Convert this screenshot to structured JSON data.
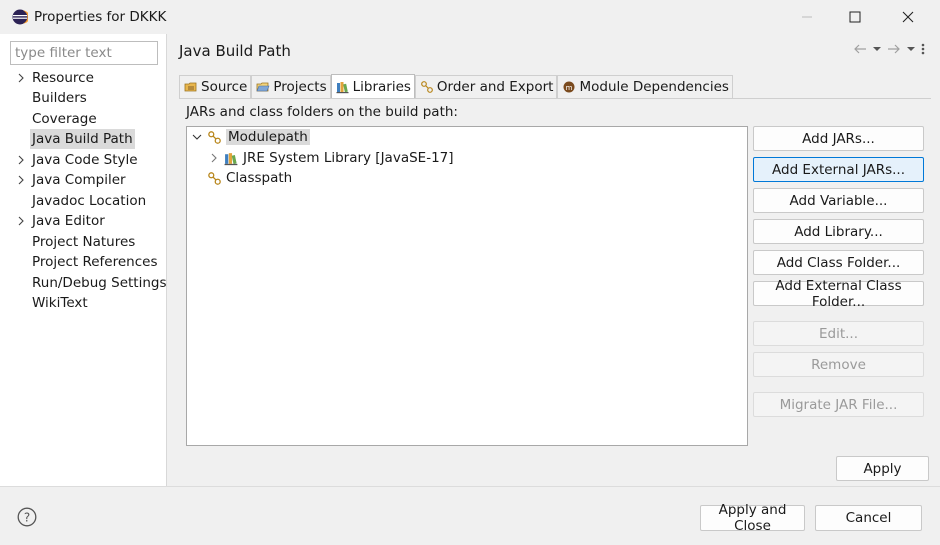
{
  "window": {
    "title": "Properties for DKKK"
  },
  "sidebar": {
    "filter_placeholder": "type filter text",
    "items": [
      {
        "label": "Resource",
        "expandable": true
      },
      {
        "label": "Builders",
        "expandable": false
      },
      {
        "label": "Coverage",
        "expandable": false
      },
      {
        "label": "Java Build Path",
        "expandable": false,
        "selected": true
      },
      {
        "label": "Java Code Style",
        "expandable": true
      },
      {
        "label": "Java Compiler",
        "expandable": true
      },
      {
        "label": "Javadoc Location",
        "expandable": false
      },
      {
        "label": "Java Editor",
        "expandable": true
      },
      {
        "label": "Project Natures",
        "expandable": false
      },
      {
        "label": "Project References",
        "expandable": false
      },
      {
        "label": "Run/Debug Settings",
        "expandable": false
      },
      {
        "label": "WikiText",
        "expandable": false
      }
    ]
  },
  "page": {
    "title": "Java Build Path",
    "tabs": [
      {
        "label": "Source",
        "icon": "source-folder-icon"
      },
      {
        "label": "Projects",
        "icon": "projects-folder-icon"
      },
      {
        "label": "Libraries",
        "icon": "libraries-icon",
        "active": true
      },
      {
        "label": "Order and Export",
        "icon": "order-export-icon"
      },
      {
        "label": "Module Dependencies",
        "icon": "module-icon"
      }
    ],
    "section_label": "JARs and class folders on the build path:",
    "tree": [
      {
        "label": "Modulepath",
        "icon": "classpath-container-icon",
        "expanded": true,
        "selected": true
      },
      {
        "label": "JRE System Library [JavaSE-17]",
        "icon": "library-icon",
        "expanded": false
      },
      {
        "label": "Classpath",
        "icon": "classpath-container-icon"
      }
    ],
    "buttons": {
      "add_jars": "Add JARs...",
      "add_external_jars": "Add External JARs...",
      "add_variable": "Add Variable...",
      "add_library": "Add Library...",
      "add_class_folder": "Add Class Folder...",
      "add_external_class_folder": "Add External Class Folder...",
      "edit": "Edit...",
      "remove": "Remove",
      "migrate_jar": "Migrate JAR File..."
    },
    "apply": "Apply"
  },
  "footer": {
    "apply_and_close": "Apply and Close",
    "cancel": "Cancel"
  }
}
